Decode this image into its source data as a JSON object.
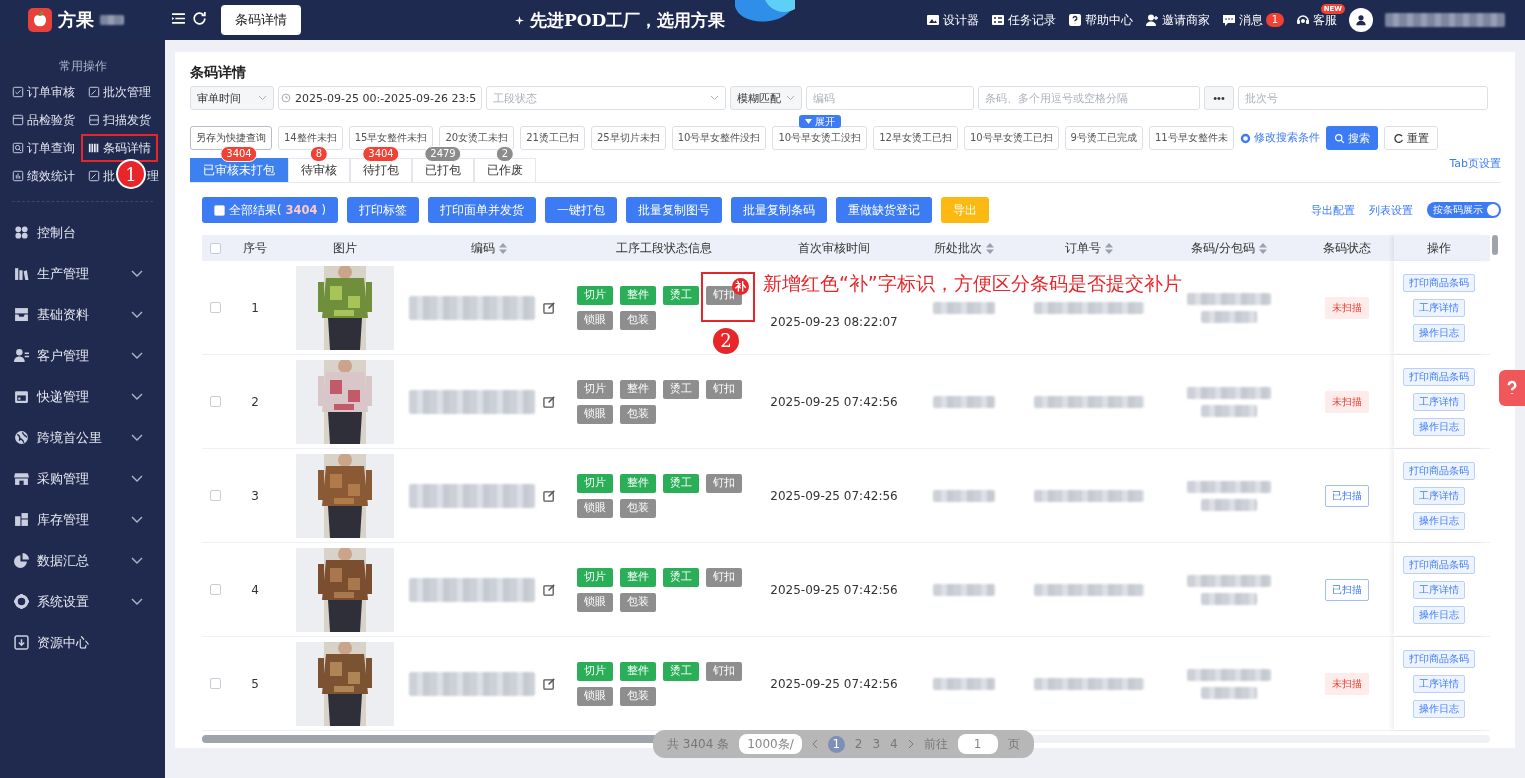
{
  "app": {
    "brand": "方果",
    "page_tab": "条码详情",
    "banner": "先进POD工厂，选用方果"
  },
  "top_links": [
    {
      "label": "设计器",
      "kind": "designer"
    },
    {
      "label": "任务记录",
      "kind": "tasks"
    },
    {
      "label": "帮助中心",
      "kind": "help"
    },
    {
      "label": "邀请商家",
      "kind": "invite"
    },
    {
      "label": "消息",
      "kind": "message",
      "badge": "1"
    },
    {
      "label": "客服",
      "kind": "service",
      "badge": "NEW"
    }
  ],
  "sidebar": {
    "quick_title": "常用操作",
    "quick_rows": [
      [
        {
          "label": "订单审核",
          "kind": "check"
        },
        {
          "label": "批次管理",
          "kind": "edit"
        }
      ],
      [
        {
          "label": "品检验货",
          "kind": "box"
        },
        {
          "label": "扫描发货",
          "kind": "scan"
        }
      ],
      [
        {
          "label": "订单查询",
          "kind": "search"
        },
        {
          "label": "条码详情",
          "kind": "barcode",
          "annotation": "1"
        }
      ],
      [
        {
          "label": "绩效统计",
          "kind": "chart"
        },
        {
          "label": "批",
          "label_end": "理",
          "kind": "edit"
        }
      ]
    ],
    "nav_items": [
      {
        "label": "控制台",
        "kind": "dashboard",
        "expandable": false
      },
      {
        "label": "生产管理",
        "kind": "factory",
        "expandable": true
      },
      {
        "label": "基础资料",
        "kind": "tray",
        "expandable": true
      },
      {
        "label": "客户管理",
        "kind": "people",
        "expandable": true
      },
      {
        "label": "快递管理",
        "kind": "calendar",
        "expandable": true
      },
      {
        "label": "跨境首公里",
        "kind": "globe",
        "expandable": true
      },
      {
        "label": "采购管理",
        "kind": "store",
        "expandable": true
      },
      {
        "label": "库存管理",
        "kind": "blocks",
        "expandable": true
      },
      {
        "label": "数据汇总",
        "kind": "pie",
        "expandable": true
      },
      {
        "label": "系统设置",
        "kind": "gear",
        "expandable": true
      },
      {
        "label": "资源中心",
        "kind": "download",
        "expandable": false
      }
    ]
  },
  "page": {
    "title": "条码详情",
    "filters": [
      {
        "kind": "time_select",
        "value": "审单时间"
      },
      {
        "kind": "date_range",
        "value": "2025-09-25 00:-2025-09-26 23:5"
      },
      {
        "kind": "status_select",
        "placeholder": "工段状态"
      },
      {
        "kind": "match_select",
        "value": "模糊匹配"
      },
      {
        "kind": "code_input",
        "placeholder": "编码"
      },
      {
        "kind": "barcode_input",
        "placeholder": "条码、多个用逗号或空格分隔"
      },
      {
        "kind": "more_button",
        "label": "•••"
      },
      {
        "kind": "batch_input",
        "placeholder": "批次号"
      }
    ],
    "save_query": "另存为快捷查询",
    "quick_queries": [
      {
        "label": "14整件未扫"
      },
      {
        "label": "15早女整件未扫"
      },
      {
        "label": "20女烫工未扫"
      },
      {
        "label": "21烫工已扫"
      },
      {
        "label": "25早切片未扫"
      },
      {
        "label": "10号早女整件没扫"
      },
      {
        "label": "10号早女烫工没扫",
        "expand_label": "展开"
      },
      {
        "label": "12早女烫工已扫"
      },
      {
        "label": "10号早女烫工已扫"
      },
      {
        "label": "9号烫工已完成"
      },
      {
        "label": "11号早女整件未"
      }
    ],
    "modify_link": "修改搜索条件",
    "search_button": "搜索",
    "reset_button": "重置"
  },
  "tabs": [
    {
      "label": "已审核未打包",
      "count": "3404",
      "color": "#f04134",
      "selected": true
    },
    {
      "label": "待审核",
      "count": "8",
      "color": "#f04134",
      "selected": false
    },
    {
      "label": "待打包",
      "count": "3404",
      "color": "#f04134",
      "selected": false
    },
    {
      "label": "已打包",
      "count": "2479",
      "color": "#8c8c8c",
      "selected": false
    },
    {
      "label": "已作废",
      "count": "2",
      "color": "#8c8c8c",
      "selected": false
    }
  ],
  "tab_settings": "Tab页设置",
  "toolbar": {
    "select_all": {
      "label": "全部结果(",
      "count": "3404",
      "suffix": ")",
      "checked": false
    },
    "buttons": [
      {
        "label": "打印标签",
        "kind": "primary"
      },
      {
        "label": "打印面单并发货",
        "kind": "primary"
      },
      {
        "label": "一键打包",
        "kind": "primary"
      },
      {
        "label": "批量复制图号",
        "kind": "primary"
      },
      {
        "label": "批量复制条码",
        "kind": "primary"
      },
      {
        "label": "重做缺货登记",
        "kind": "primary"
      },
      {
        "label": "导出",
        "kind": "warning"
      }
    ],
    "links": [
      "导出配置",
      "列表设置"
    ],
    "toggle": {
      "label": "按条码展示",
      "on": true
    }
  },
  "table": {
    "header_checked": false,
    "columns": [
      {
        "label": "序号",
        "sortable": false
      },
      {
        "label": "图片",
        "sortable": false
      },
      {
        "label": "编码",
        "sortable": true
      },
      {
        "label": "工序工段状态信息",
        "sortable": false
      },
      {
        "label": "首次审核时间",
        "sortable": false
      },
      {
        "label": "所处批次",
        "sortable": true
      },
      {
        "label": "订单号",
        "sortable": true
      },
      {
        "label": "条码/分包码",
        "sortable": true
      },
      {
        "label": "条码状态",
        "sortable": false
      },
      {
        "label": "操作",
        "sortable": false
      }
    ],
    "rows": [
      {
        "index": "1",
        "checked": false,
        "picture": {
          "kind": "picture"
        },
        "processes": [
          {
            "label": "切片",
            "done": true
          },
          {
            "label": "整件",
            "done": true
          },
          {
            "label": "烫工",
            "done": true
          },
          {
            "label": "钉扣",
            "done": false,
            "badge": "补",
            "annotation": "2"
          },
          {
            "label": "锁眼",
            "done": false
          },
          {
            "label": "包装",
            "done": false
          }
        ],
        "review_time": "2025-09-23 08:22:07",
        "status": {
          "label": "未扫描",
          "scanned": false
        },
        "actions": [
          "打印商品条码",
          "工序详情",
          "操作日志"
        ],
        "note": "新增红色“补”字标识，方便区分条码是否提交补片"
      },
      {
        "index": "2",
        "checked": false,
        "picture": {
          "kind": "picture"
        },
        "processes": [
          {
            "label": "切片",
            "done": false
          },
          {
            "label": "整件",
            "done": false
          },
          {
            "label": "烫工",
            "done": false
          },
          {
            "label": "钉扣",
            "done": false
          },
          {
            "label": "锁眼",
            "done": false
          },
          {
            "label": "包装",
            "done": false
          }
        ],
        "review_time": "2025-09-25 07:42:56",
        "status": {
          "label": "未扫描",
          "scanned": false
        },
        "actions": [
          "打印商品条码",
          "工序详情",
          "操作日志"
        ]
      },
      {
        "index": "3",
        "checked": false,
        "picture": {
          "kind": "picture"
        },
        "processes": [
          {
            "label": "切片",
            "done": true
          },
          {
            "label": "整件",
            "done": true
          },
          {
            "label": "烫工",
            "done": true
          },
          {
            "label": "钉扣",
            "done": false
          },
          {
            "label": "锁眼",
            "done": false
          },
          {
            "label": "包装",
            "done": false
          }
        ],
        "review_time": "2025-09-25 07:42:56",
        "status": {
          "label": "已扫描",
          "scanned": true
        },
        "actions": [
          "打印商品条码",
          "工序详情",
          "操作日志"
        ]
      },
      {
        "index": "4",
        "checked": false,
        "picture": {
          "kind": "picture"
        },
        "processes": [
          {
            "label": "切片",
            "done": true
          },
          {
            "label": "整件",
            "done": true
          },
          {
            "label": "烫工",
            "done": true
          },
          {
            "label": "钉扣",
            "done": false
          },
          {
            "label": "锁眼",
            "done": false
          },
          {
            "label": "包装",
            "done": false
          }
        ],
        "review_time": "2025-09-25 07:42:56",
        "status": {
          "label": "已扫描",
          "scanned": true
        },
        "actions": [
          "打印商品条码",
          "工序详情",
          "操作日志"
        ]
      },
      {
        "index": "5",
        "checked": false,
        "picture": {
          "kind": "picture"
        },
        "processes": [
          {
            "label": "切片",
            "done": true
          },
          {
            "label": "整件",
            "done": true
          },
          {
            "label": "烫工",
            "done": true
          },
          {
            "label": "钉扣",
            "done": false
          },
          {
            "label": "锁眼",
            "done": false
          },
          {
            "label": "包装",
            "done": false
          }
        ],
        "review_time": "2025-09-25 07:42:56",
        "status": {
          "label": "未扫描",
          "scanned": false
        },
        "actions": [
          "打印商品条码",
          "工序详情",
          "操作日志"
        ]
      }
    ]
  },
  "pagination": {
    "total": "共 3404 条",
    "page_size": "1000条/",
    "pages": [
      {
        "label": "1",
        "selected": true
      },
      {
        "label": "2",
        "selected": false
      },
      {
        "label": "3",
        "selected": false
      },
      {
        "label": "4",
        "selected": false
      }
    ],
    "goto_label": "前往",
    "goto_value": "1",
    "suffix": "页"
  }
}
